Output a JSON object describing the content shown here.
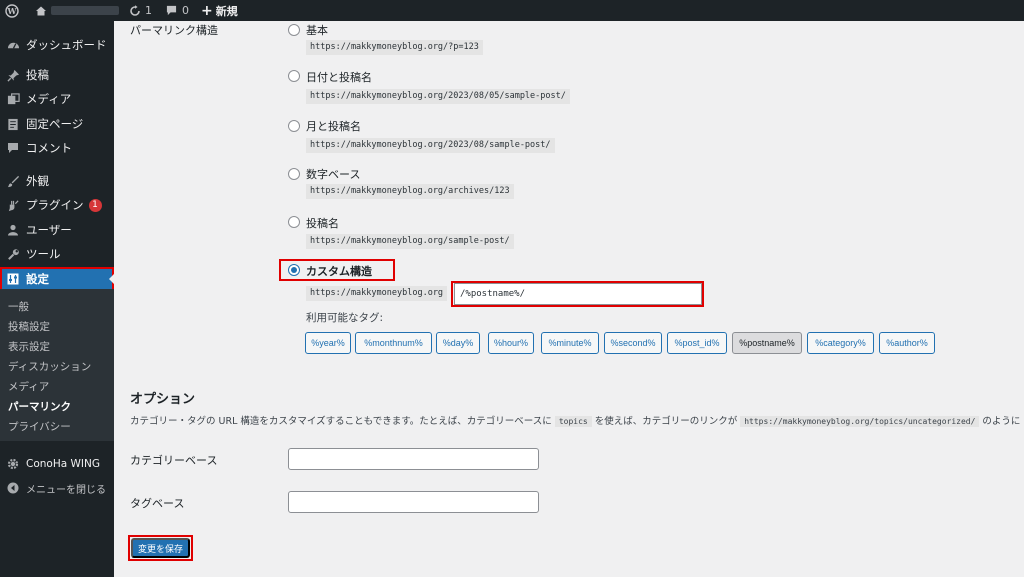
{
  "adminbar": {
    "comments_count": "1",
    "updates_count": "0",
    "new_label": "新規"
  },
  "sidebar": {
    "items": [
      {
        "label": "ダッシュボード",
        "icon": "dashboard-icon"
      },
      {
        "label": "投稿",
        "icon": "pin-icon"
      },
      {
        "label": "メディア",
        "icon": "media-icon"
      },
      {
        "label": "固定ページ",
        "icon": "page-icon"
      },
      {
        "label": "コメント",
        "icon": "comment-icon"
      },
      {
        "label": "外観",
        "icon": "appearance-icon"
      },
      {
        "label": "プラグイン",
        "icon": "plugin-icon",
        "badge": "1"
      },
      {
        "label": "ユーザー",
        "icon": "user-icon"
      },
      {
        "label": "ツール",
        "icon": "wrench-icon"
      },
      {
        "label": "設定",
        "icon": "settings-icon",
        "current": true
      }
    ],
    "submenu": [
      "一般",
      "投稿設定",
      "表示設定",
      "ディスカッション",
      "メディア",
      "パーマリンク",
      "プライバシー"
    ],
    "conoha": "ConoHa WING",
    "collapse": "メニューを閉じる"
  },
  "main": {
    "section_label": "パーマリンク構造",
    "options": [
      {
        "label": "基本",
        "example": "https://makkymoneyblog.org/?p=123"
      },
      {
        "label": "日付と投稿名",
        "example": "https://makkymoneyblog.org/2023/08/05/sample-post/"
      },
      {
        "label": "月と投稿名",
        "example": "https://makkymoneyblog.org/2023/08/sample-post/"
      },
      {
        "label": "数字ベース",
        "example": "https://makkymoneyblog.org/archives/123"
      },
      {
        "label": "投稿名",
        "example": "https://makkymoneyblog.org/sample-post/"
      },
      {
        "label": "カスタム構造",
        "example": "https://makkymoneyblog.org",
        "checked": true
      }
    ],
    "custom_value": "/%postname%/",
    "available_tags_label": "利用可能なタグ:",
    "tags": [
      "%year%",
      "%monthnum%",
      "%day%",
      "%hour%",
      "%minute%",
      "%second%",
      "%post_id%",
      "%postname%",
      "%category%",
      "%author%"
    ],
    "active_tag": "%postname%",
    "options_heading": "オプション",
    "options_desc_1": "カテゴリー・タグの URL 構造をカスタマイズすることもできます。たとえば、カテゴリーベースに",
    "options_desc_code1": "topics",
    "options_desc_2": "を使えば、カテゴリーのリンクが",
    "options_desc_code2": "https://makkymoneyblog.org/topics/uncategorized/",
    "options_desc_3": "のように",
    "category_base_label": "カテゴリーベース",
    "tag_base_label": "タグベース",
    "save_label": "変更を保存"
  },
  "colors": {
    "accent": "#2271b1",
    "sidebar_bg": "#1d2327",
    "highlight_border": "#e00000"
  }
}
